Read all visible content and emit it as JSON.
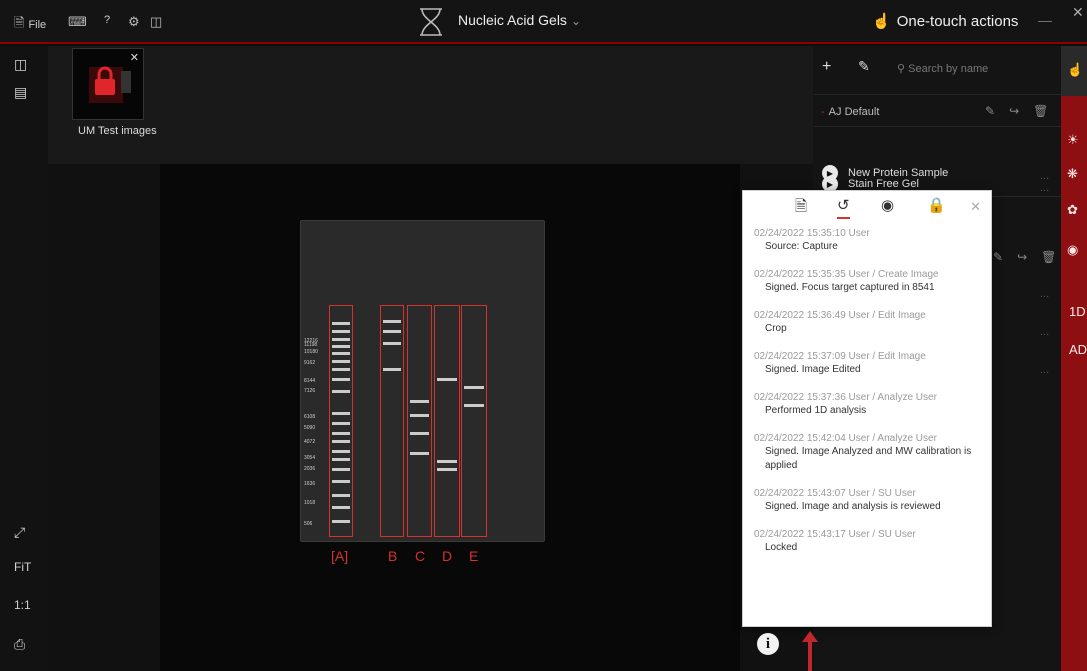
{
  "titlebar": {
    "file_label": "File",
    "help_label": "?",
    "app_title": "Nucleic Acid Gels",
    "one_touch_label": "One-touch actions"
  },
  "thumbnail": {
    "label": "UM Test images"
  },
  "left_toolbar": {
    "fit_label": "FiT",
    "one_to_one_label": "1:1"
  },
  "gel": {
    "lanes": [
      "[A]",
      "B",
      "C",
      "D",
      "E"
    ],
    "mw_labels": [
      "12216",
      "11198",
      "10180",
      "9162",
      "8144",
      "7126",
      "6108",
      "5090",
      "4072",
      "3054",
      "2036",
      "1636",
      "1018",
      "506"
    ]
  },
  "protocol_panel": {
    "search_placeholder": "Search by name",
    "group_name": "AJ Default",
    "protocols": [
      "New Protein Sample",
      "Stain Free Gel"
    ],
    "dots": "..."
  },
  "red_sidebar": {
    "label_1d": "1D",
    "label_ad": "AD"
  },
  "history": {
    "entries": [
      {
        "meta": "02/24/2022 15:35:10 User",
        "desc": "Source: Capture"
      },
      {
        "meta": "02/24/2022 15:35:35 User / Create Image",
        "desc": "Signed. Focus target captured in 8541"
      },
      {
        "meta": "02/24/2022 15:36:49 User / Edit Image",
        "desc": "Crop"
      },
      {
        "meta": "02/24/2022 15:37:09 User / Edit Image",
        "desc": "Signed. Image Edited"
      },
      {
        "meta": "02/24/2022 15:37:36 User / Analyze User",
        "desc": "Performed 1D analysis"
      },
      {
        "meta": "02/24/2022 15:42:04 User / Analyze User",
        "desc": "Signed. Image Analyzed and MW calibration is applied"
      },
      {
        "meta": "02/24/2022 15:43:07 User / SU User",
        "desc": "Signed. Image and analysis is reviewed"
      },
      {
        "meta": "02/24/2022 15:43:17 User / SU User",
        "desc": "Locked"
      }
    ]
  },
  "info_button": "i",
  "colors": {
    "accent_red": "#d3332b",
    "sidebar_red": "#8e0f12"
  },
  "icons": [
    "file-icon",
    "keyboard-icon",
    "gear-icon",
    "display-icon",
    "dna-logo-icon",
    "touch-icon",
    "folder-icon",
    "save-icon",
    "expand-icon",
    "print-icon",
    "brightness-icon",
    "plus-icon",
    "edit-icon",
    "search-icon",
    "pencil-icon",
    "export-icon",
    "trash-icon",
    "play-icon",
    "document-icon",
    "history-icon",
    "camera-icon",
    "lock-icon",
    "close-icon",
    "bulb-icon",
    "aperture-icon",
    "filter-icon"
  ]
}
